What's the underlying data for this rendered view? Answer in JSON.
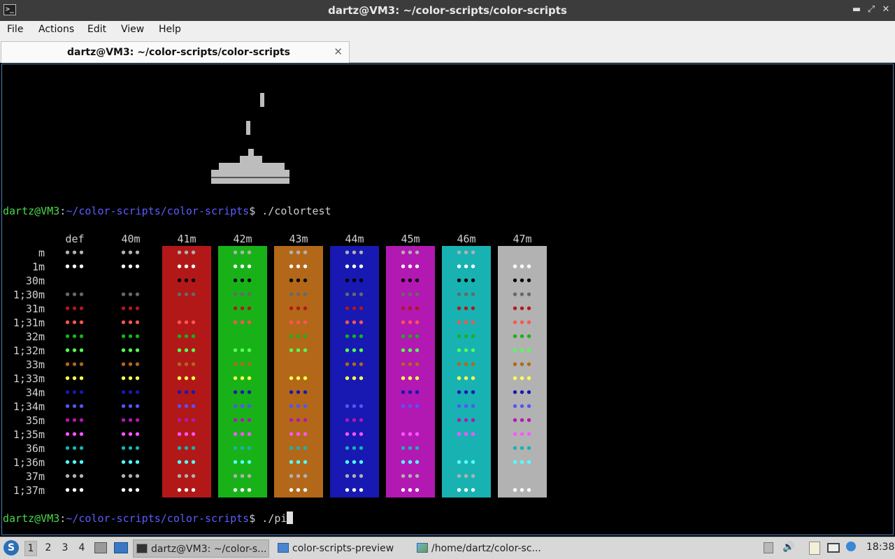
{
  "window": {
    "title": "dartz@VM3: ~/color-scripts/color-scripts",
    "icon": "terminal-icon",
    "controls": {
      "minimize": "▬",
      "restore": "⤢",
      "close": "✕"
    }
  },
  "menu": {
    "file": "File",
    "actions": "Actions",
    "edit": "Edit",
    "view": "View",
    "help": "Help"
  },
  "tab": {
    "label": "dartz@VM3: ~/color-scripts/color-scripts",
    "close": "✕"
  },
  "terminal": {
    "prompt": {
      "user_host": "dartz@VM3",
      "colon": ":",
      "path": "~/color-scripts/color-scripts",
      "dollar": "$ "
    },
    "command1": "./colortest",
    "command2": "./pi",
    "colortest": {
      "columns": [
        "def",
        "40m",
        "41m",
        "42m",
        "43m",
        "44m",
        "45m",
        "46m",
        "47m"
      ],
      "backgrounds": {
        "41m": "#b21818",
        "42m": "#18b218",
        "43m": "#b26818",
        "44m": "#1818b2",
        "45m": "#b218b2",
        "46m": "#18b2b2",
        "47m": "#b2b2b2"
      },
      "rows": [
        {
          "label": "m",
          "fg": "#b2b2b2"
        },
        {
          "label": "1m",
          "fg": "#ffffff"
        },
        {
          "label": "30m",
          "fg": "#000000"
        },
        {
          "label": "1;30m",
          "fg": "#686868"
        },
        {
          "label": "31m",
          "fg": "#b21818"
        },
        {
          "label": "1;31m",
          "fg": "#ff5454"
        },
        {
          "label": "32m",
          "fg": "#18b218"
        },
        {
          "label": "1;32m",
          "fg": "#54ff54"
        },
        {
          "label": "33m",
          "fg": "#b26818"
        },
        {
          "label": "1;33m",
          "fg": "#ffff54"
        },
        {
          "label": "34m",
          "fg": "#1818b2"
        },
        {
          "label": "1;34m",
          "fg": "#5454ff"
        },
        {
          "label": "35m",
          "fg": "#b218b2"
        },
        {
          "label": "1;35m",
          "fg": "#ff54ff"
        },
        {
          "label": "36m",
          "fg": "#18b2b2"
        },
        {
          "label": "1;36m",
          "fg": "#54ffff"
        },
        {
          "label": "37m",
          "fg": "#b2b2b2"
        },
        {
          "label": "1;37m",
          "fg": "#ffffff"
        }
      ],
      "sample": "•••"
    }
  },
  "taskbar": {
    "start_icon": "lxqt-start-icon",
    "workspaces": [
      "1",
      "2",
      "3",
      "4"
    ],
    "active_workspace": "1",
    "launchers": [
      "file-manager-icon",
      "show-desktop-icon"
    ],
    "tasks": [
      {
        "label": "dartz@VM3: ~/color-s...",
        "icon": "terminal-icon"
      },
      {
        "label": "color-scripts-preview",
        "icon": "folder-icon"
      },
      {
        "label": "/home/dartz/color-sc...",
        "icon": "image-viewer-icon"
      }
    ],
    "tray": [
      "trash-icon",
      "volume-icon",
      "clipboard-icon",
      "network-icon",
      "updates-icon"
    ],
    "clock": "18:38"
  }
}
